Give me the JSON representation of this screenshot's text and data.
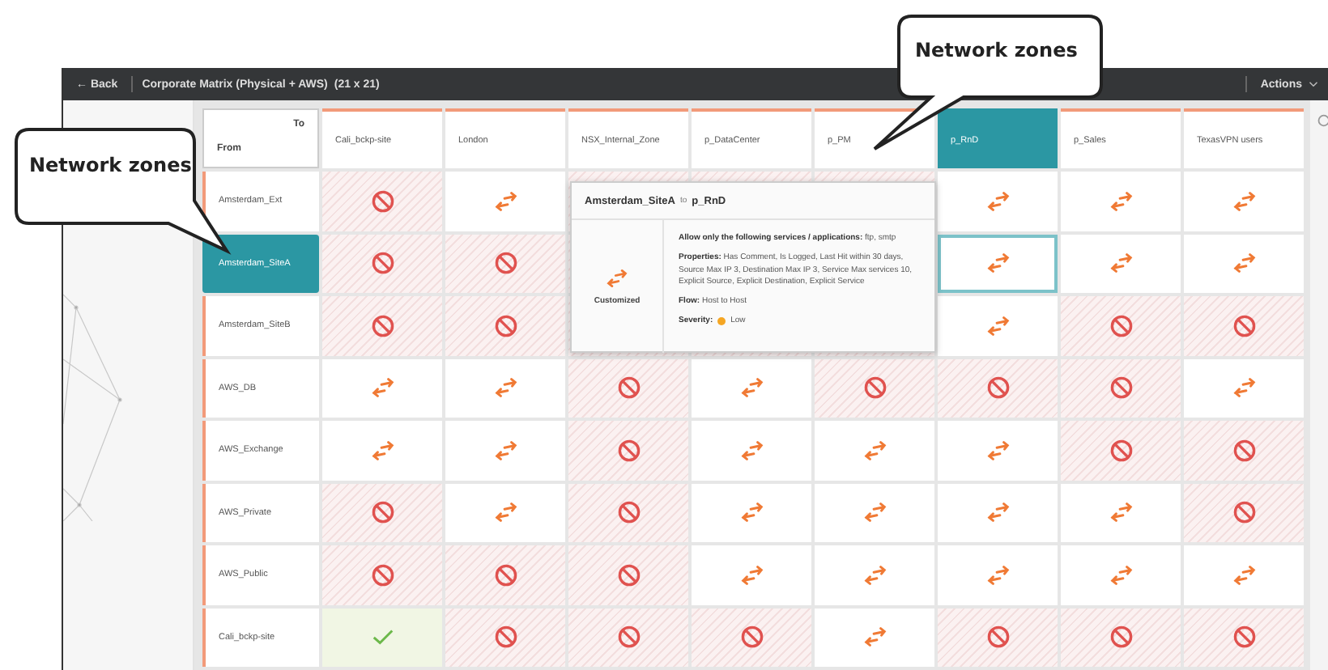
{
  "top_bar": {
    "back": "← Back",
    "title": "Corporate Matrix (Physical + AWS)",
    "size": "(21 x 21)",
    "actions": "Actions"
  },
  "matrix": {
    "corner_to": "To",
    "corner_from": "From",
    "columns": [
      {
        "label": "Cali_bckp-site",
        "selected": false
      },
      {
        "label": "London",
        "selected": false
      },
      {
        "label": "NSX_Internal_Zone",
        "selected": false
      },
      {
        "label": "p_DataCenter",
        "selected": false
      },
      {
        "label": "p_PM",
        "selected": false
      },
      {
        "label": "p_RnD",
        "selected": true
      },
      {
        "label": "p_Sales",
        "selected": false
      },
      {
        "label": "TexasVPN users",
        "selected": false
      }
    ],
    "rows": [
      {
        "label": "Amsterdam_Ext",
        "selected": false,
        "cells": [
          {
            "kind": "block",
            "selected": false
          },
          {
            "kind": "allow",
            "selected": false
          },
          {
            "kind": "covered"
          },
          {
            "kind": "covered"
          },
          {
            "kind": "covered"
          },
          {
            "kind": "allow",
            "selected": false
          },
          {
            "kind": "allow",
            "selected": false
          },
          {
            "kind": "allow",
            "selected": false
          }
        ]
      },
      {
        "label": "Amsterdam_SiteA",
        "selected": true,
        "cells": [
          {
            "kind": "block",
            "selected": false
          },
          {
            "kind": "block",
            "selected": false
          },
          {
            "kind": "covered"
          },
          {
            "kind": "covered"
          },
          {
            "kind": "covered"
          },
          {
            "kind": "allow",
            "selected": true
          },
          {
            "kind": "allow",
            "selected": false
          },
          {
            "kind": "allow",
            "selected": false
          }
        ]
      },
      {
        "label": "Amsterdam_SiteB",
        "selected": false,
        "cells": [
          {
            "kind": "block",
            "selected": false
          },
          {
            "kind": "block",
            "selected": false
          },
          {
            "kind": "covered"
          },
          {
            "kind": "covered"
          },
          {
            "kind": "covered"
          },
          {
            "kind": "allow",
            "selected": false
          },
          {
            "kind": "block",
            "selected": false
          },
          {
            "kind": "block",
            "selected": false
          }
        ]
      },
      {
        "label": "AWS_DB",
        "selected": false,
        "cells": [
          {
            "kind": "allow",
            "selected": false
          },
          {
            "kind": "allow",
            "selected": false
          },
          {
            "kind": "block",
            "selected": false
          },
          {
            "kind": "allow",
            "selected": false
          },
          {
            "kind": "block",
            "selected": false
          },
          {
            "kind": "block",
            "selected": false
          },
          {
            "kind": "block",
            "selected": false
          },
          {
            "kind": "allow",
            "selected": false
          }
        ]
      },
      {
        "label": "AWS_Exchange",
        "selected": false,
        "cells": [
          {
            "kind": "allow",
            "selected": false
          },
          {
            "kind": "allow",
            "selected": false
          },
          {
            "kind": "block",
            "selected": false
          },
          {
            "kind": "allow",
            "selected": false
          },
          {
            "kind": "allow",
            "selected": false
          },
          {
            "kind": "allow",
            "selected": false
          },
          {
            "kind": "block",
            "selected": false
          },
          {
            "kind": "block",
            "selected": false
          }
        ]
      },
      {
        "label": "AWS_Private",
        "selected": false,
        "cells": [
          {
            "kind": "block",
            "selected": false
          },
          {
            "kind": "allow",
            "selected": false
          },
          {
            "kind": "block",
            "selected": false
          },
          {
            "kind": "allow",
            "selected": false
          },
          {
            "kind": "allow",
            "selected": false
          },
          {
            "kind": "allow",
            "selected": false
          },
          {
            "kind": "allow",
            "selected": false
          },
          {
            "kind": "block",
            "selected": false
          }
        ]
      },
      {
        "label": "AWS_Public",
        "selected": false,
        "cells": [
          {
            "kind": "block",
            "selected": false
          },
          {
            "kind": "block",
            "selected": false
          },
          {
            "kind": "block",
            "selected": false
          },
          {
            "kind": "allow",
            "selected": false
          },
          {
            "kind": "allow",
            "selected": false
          },
          {
            "kind": "allow",
            "selected": false
          },
          {
            "kind": "allow",
            "selected": false
          },
          {
            "kind": "allow",
            "selected": false
          }
        ]
      },
      {
        "label": "Cali_bckp-site",
        "selected": false,
        "cells": [
          {
            "kind": "check",
            "selected": false
          },
          {
            "kind": "block",
            "selected": false
          },
          {
            "kind": "block",
            "selected": false
          },
          {
            "kind": "block",
            "selected": false
          },
          {
            "kind": "allow",
            "selected": false
          },
          {
            "kind": "block",
            "selected": false
          },
          {
            "kind": "block",
            "selected": false
          },
          {
            "kind": "block",
            "selected": false
          }
        ]
      }
    ]
  },
  "popover": {
    "from": "Amsterdam_SiteA",
    "connector": "to",
    "to": "p_RnD",
    "status": "Customized",
    "rule": "**Allow only the following services / applications:** ftp, smtp",
    "properties": "**Properties:** Has Comment, Is Logged, Last Hit within 30 days, Source Max IP 3, Destination Max IP 3, Service Max services 10, Explicit Source, Explicit Destination, Explicit Service",
    "flow": "**Flow:** Host to Host",
    "severity_label": "Severity:",
    "severity": "Low"
  },
  "callouts": [
    {
      "text": "Network zones"
    },
    {
      "text": "Network zones"
    }
  ]
}
